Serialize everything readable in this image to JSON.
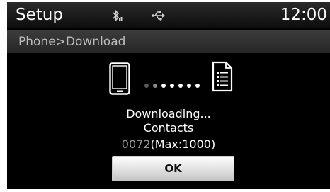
{
  "header": {
    "title": "Setup",
    "time": "12:00",
    "status_icons": [
      "bluetooth-icon",
      "usb-icon"
    ]
  },
  "breadcrumb": "Phone>Download",
  "transfer": {
    "source_icon": "phone-icon",
    "target_icon": "document-list-icon"
  },
  "message": {
    "line1": "Downloading...",
    "line2": "Contacts",
    "count": "0072",
    "max": "(Max:1000)"
  },
  "buttons": {
    "ok_label": "OK"
  },
  "colors": {
    "background": "#000000",
    "text": "#ffffff",
    "muted_text": "#9a9a9a"
  }
}
